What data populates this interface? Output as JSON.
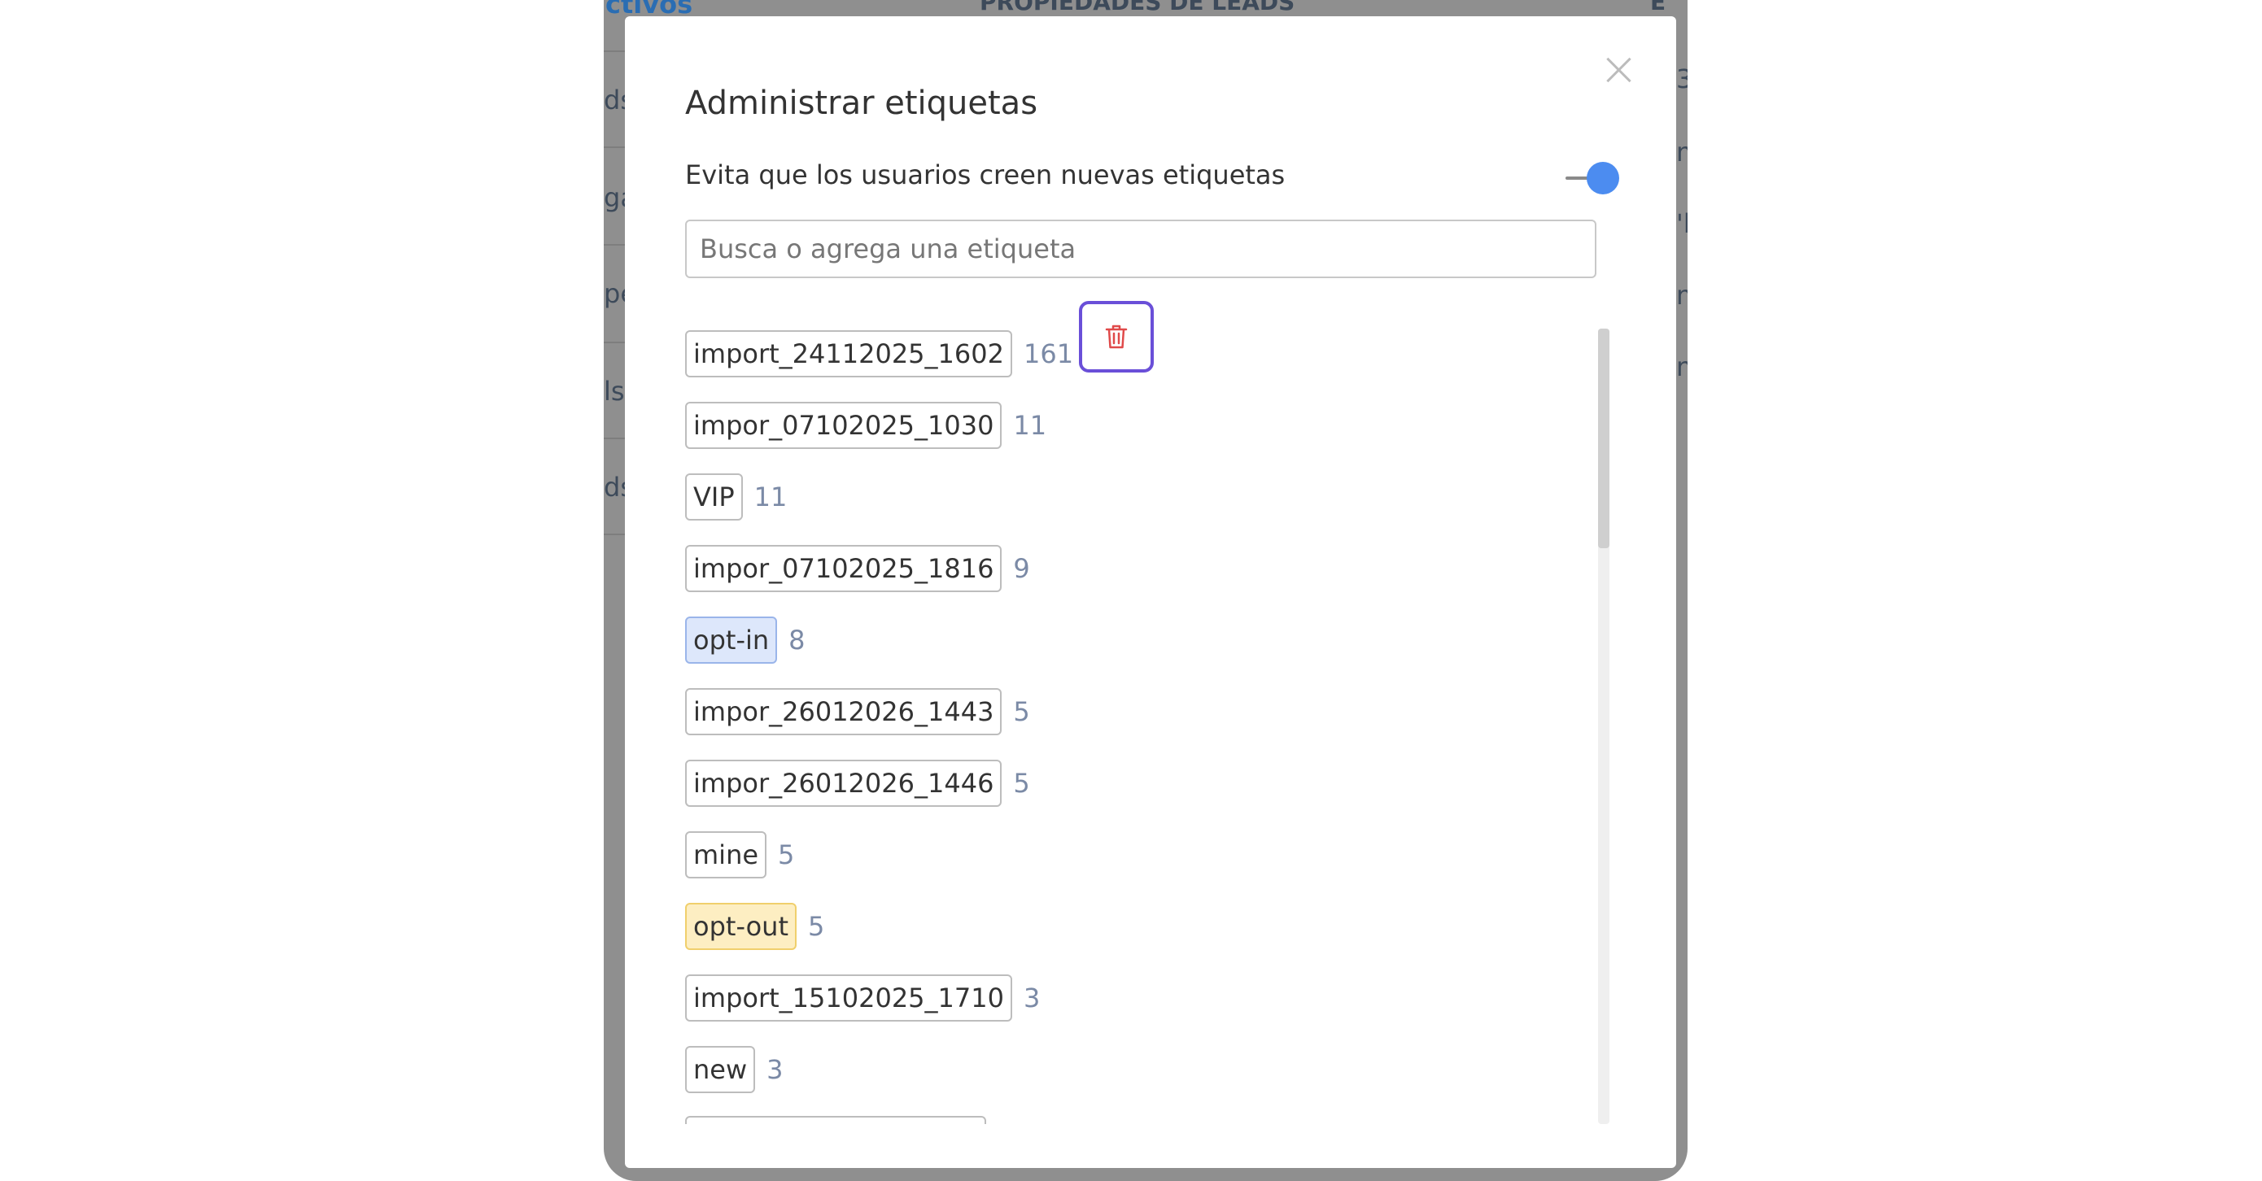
{
  "background": {
    "fragments": [
      {
        "text": "ctivos",
        "color": "#2a6db3"
      },
      {
        "text": "PROPIEDADES DE LEADS",
        "color": "#3d4a5a"
      },
      {
        "text": "E",
        "color": "#3d4a5a"
      },
      {
        "text": "ds",
        "color": "#3d4a5a"
      },
      {
        "text": "ga",
        "color": "#3d4a5a"
      },
      {
        "text": "pe",
        "color": "#3d4a5a"
      },
      {
        "text": "ls",
        "color": "#3d4a5a"
      },
      {
        "text": "ds",
        "color": "#3d4a5a"
      },
      {
        "text": "3",
        "color": "#3d4a5a"
      },
      {
        "text": "m",
        "color": "#3d4a5a"
      },
      {
        "text": "'l",
        "color": "#3d4a5a"
      },
      {
        "text": "m",
        "color": "#3d4a5a"
      },
      {
        "text": "m",
        "color": "#3d4a5a"
      }
    ]
  },
  "modal": {
    "title": "Administrar etiquetas",
    "close_icon": "close-icon",
    "toggle": {
      "label": "Evita que los usuarios creen nuevas etiquetas",
      "on": true,
      "color": "#4c8cf0"
    },
    "search": {
      "placeholder": "Busca o agrega una etiqueta",
      "value": ""
    },
    "tags": [
      {
        "name": "import_24112025_1602",
        "count": "161",
        "style": "default"
      },
      {
        "name": "impor_07102025_1030",
        "count": "11",
        "style": "default"
      },
      {
        "name": "VIP",
        "count": "11",
        "style": "default"
      },
      {
        "name": "impor_07102025_1816",
        "count": "9",
        "style": "default"
      },
      {
        "name": "opt-in",
        "count": "8",
        "style": "blue"
      },
      {
        "name": "impor_26012026_1443",
        "count": "5",
        "style": "default"
      },
      {
        "name": "impor_26012026_1446",
        "count": "5",
        "style": "default"
      },
      {
        "name": "mine",
        "count": "5",
        "style": "default"
      },
      {
        "name": "opt-out",
        "count": "5",
        "style": "yellow"
      },
      {
        "name": "import_15102025_1710",
        "count": "3",
        "style": "default"
      },
      {
        "name": "new",
        "count": "3",
        "style": "default"
      }
    ],
    "row_actions": {
      "hide_icon": "eye-slash-icon",
      "delete_icon": "trash-icon",
      "delete_color": "#e04a4a",
      "highlight_color": "#6a4fd8"
    }
  }
}
